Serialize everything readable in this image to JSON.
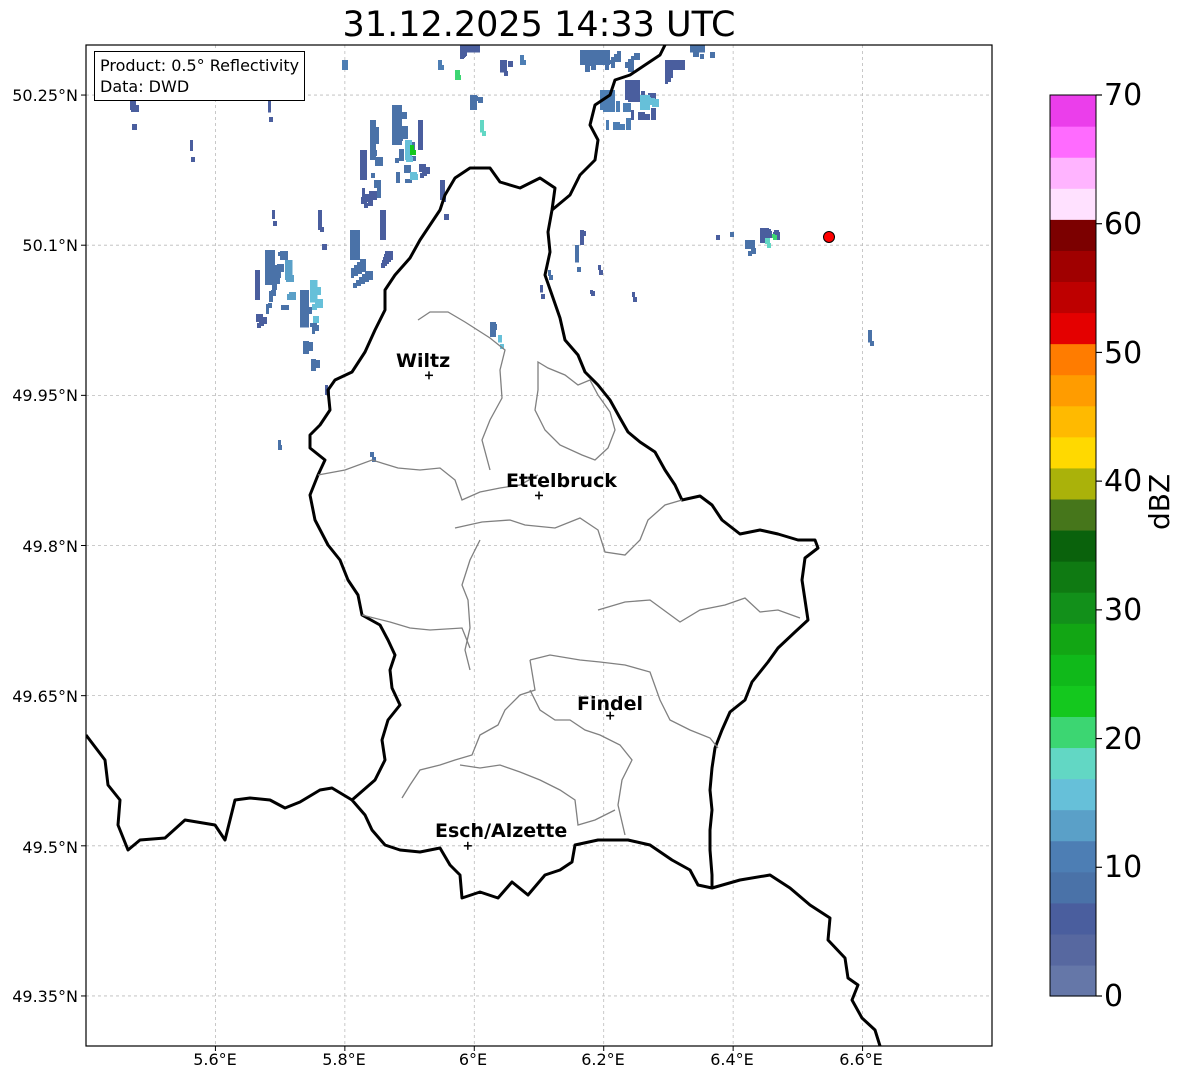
{
  "title": "31.12.2025 14:33 UTC",
  "info_box": {
    "product": "Product: 0.5° Reflectivity",
    "data": "Data: DWD"
  },
  "axes": {
    "lon_ticks": [
      "5.6°E",
      "5.8°E",
      "6°E",
      "6.2°E",
      "6.4°E",
      "6.6°E"
    ],
    "lat_ticks": [
      "50.25°N",
      "50.1°N",
      "49.95°N",
      "49.8°N",
      "49.65°N",
      "49.5°N",
      "49.35°N"
    ],
    "lon_range": [
      5.4,
      6.8
    ],
    "lat_range": [
      49.3,
      50.3
    ]
  },
  "cities": [
    {
      "name": "Wiltz",
      "lon": 5.93,
      "lat": 49.97
    },
    {
      "name": "Ettelbruck",
      "lon": 6.1,
      "lat": 49.85
    },
    {
      "name": "Findel",
      "lon": 6.21,
      "lat": 49.63
    },
    {
      "name": "Esch/Alzette",
      "lon": 5.99,
      "lat": 49.5
    }
  ],
  "colorbar": {
    "label": "dBZ",
    "ticks": [
      "70",
      "60",
      "50",
      "40",
      "30",
      "20",
      "10",
      "0"
    ],
    "colors": [
      "#6577a8",
      "#5768a0",
      "#4a5e9e",
      "#4a72a8",
      "#4d7eb4",
      "#5aa0c8",
      "#66c0d9",
      "#62d7c4",
      "#3cd672",
      "#14c81e",
      "#10b91a",
      "#12a614",
      "#12901a",
      "#0f7a12",
      "#0a620c",
      "#46761b",
      "#aab20a",
      "#ffd900",
      "#ffba00",
      "#ff9c00",
      "#ff7c00",
      "#e40000",
      "#be0000",
      "#a00000",
      "#7c0000",
      "#ffe1ff",
      "#ffb4ff",
      "#ff6bff",
      "#eb3eeb"
    ]
  },
  "station_marker": {
    "lon": 6.55,
    "lat": 50.11,
    "color": "#ff0000"
  },
  "colors": {
    "border": "#000000",
    "inner_border": "#808080",
    "grid": "#bbbbbb"
  }
}
